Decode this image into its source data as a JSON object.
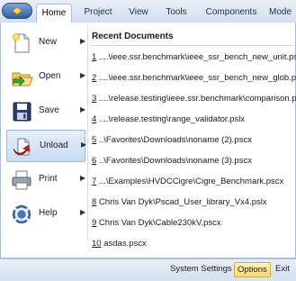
{
  "tabs": [
    "Home",
    "Project",
    "View",
    "Tools",
    "Components",
    "Mode"
  ],
  "menu": {
    "items": [
      {
        "label": "New",
        "icon": "new-document-icon"
      },
      {
        "label": "Open",
        "icon": "open-folder-icon"
      },
      {
        "label": "Save",
        "icon": "save-disk-icon"
      },
      {
        "label": "Unload",
        "icon": "unload-icon"
      },
      {
        "label": "Print",
        "icon": "printer-icon"
      },
      {
        "label": "Help",
        "icon": "help-icon"
      }
    ],
    "arrow": "▶"
  },
  "recent": {
    "title": "Recent Documents",
    "docs": [
      {
        "n": "1",
        "path": " ....\\ieee.ssr.benchmark\\ieee_ssr_bench_new_unit.pscx"
      },
      {
        "n": "2",
        "path": " ....\\ieee.ssr.benchmark\\ieee_ssr_bench_new_glob.pscx"
      },
      {
        "n": "3",
        "path": " ....\\release.testing\\ieee.ssr.benchmark\\comparison.pscx"
      },
      {
        "n": "4",
        "path": " ....\\release.testing\\range_validator.pslx"
      },
      {
        "n": "5",
        "path": " ..\\Favorites\\Downloads\\noname (2).pscx"
      },
      {
        "n": "6",
        "path": " ..\\Favorites\\Downloads\\noname (3).pscx"
      },
      {
        "n": "7",
        "path": " ...\\Examples\\HVDCCigre\\Cigre_Benchmark.pscx"
      },
      {
        "n": "8",
        "path": " Chris Van Dyk\\Pscad_User_library_Vx4.pslx"
      },
      {
        "n": "9",
        "path": " Chris Van Dyk\\Cable230kV.pscx"
      },
      {
        "n": "10",
        "path": " asdas.pscx"
      }
    ]
  },
  "footer": {
    "system_settings": "System Settings",
    "options": "Options",
    "exit": "Exit"
  }
}
